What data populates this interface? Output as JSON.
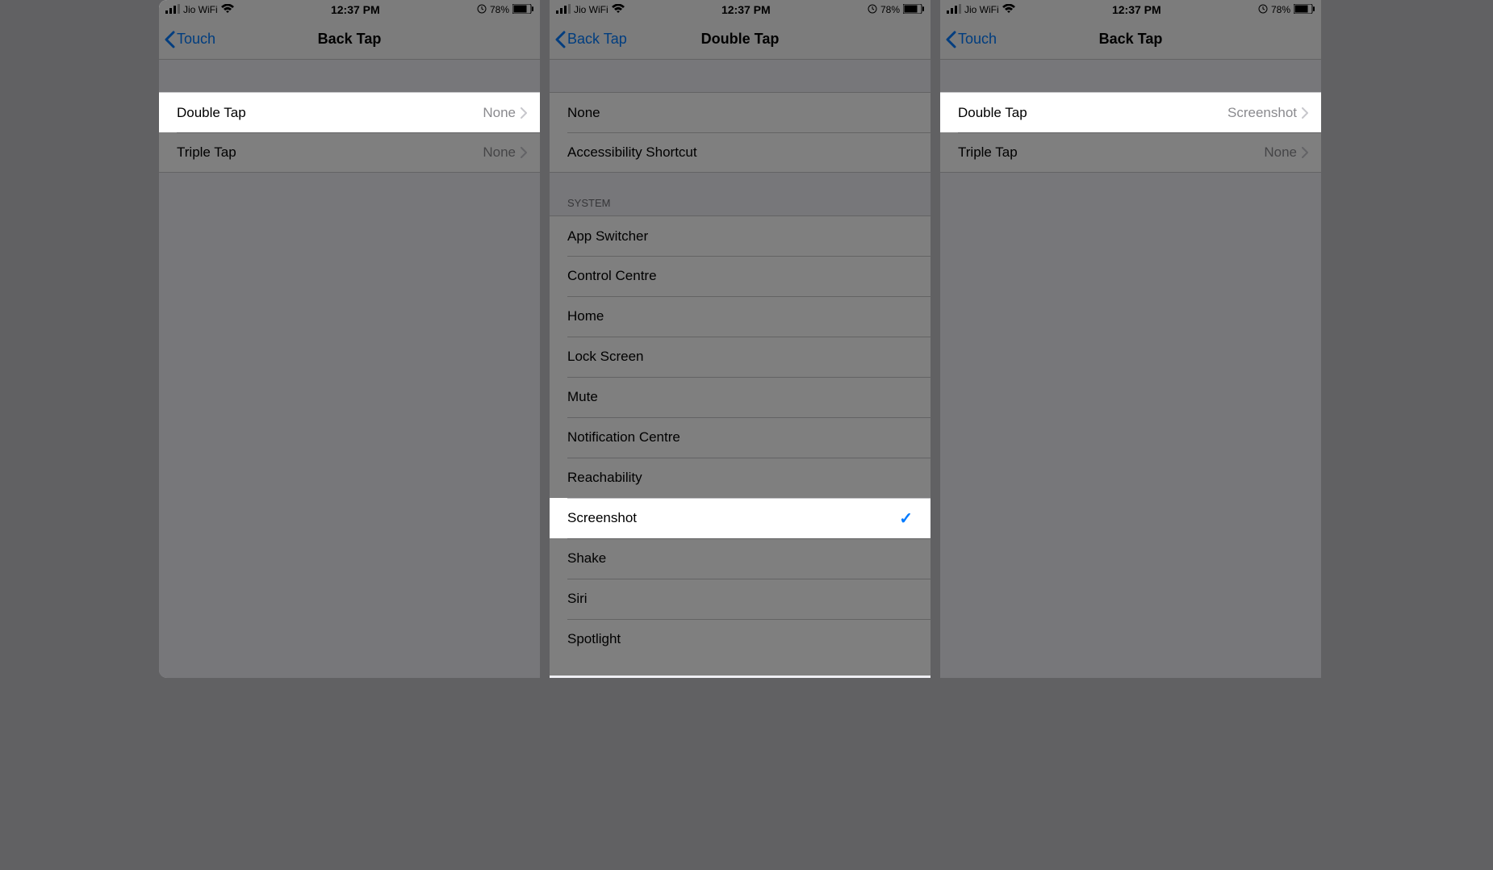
{
  "status": {
    "carrier": "Jio WiFi",
    "time": "12:37 PM",
    "battery": "78%",
    "alarm_icon": "⦿"
  },
  "screen1": {
    "back_label": "Touch",
    "title": "Back Tap",
    "rows": [
      {
        "label": "Double Tap",
        "value": "None"
      },
      {
        "label": "Triple Tap",
        "value": "None"
      }
    ]
  },
  "screen2": {
    "back_label": "Back Tap",
    "title": "Double Tap",
    "top_options": [
      "None",
      "Accessibility Shortcut"
    ],
    "section_header": "SYSTEM",
    "system_options": [
      "App Switcher",
      "Control Centre",
      "Home",
      "Lock Screen",
      "Mute",
      "Notification Centre",
      "Reachability",
      "Screenshot",
      "Shake",
      "Siri",
      "Spotlight"
    ],
    "selected": "Screenshot"
  },
  "screen3": {
    "back_label": "Touch",
    "title": "Back Tap",
    "rows": [
      {
        "label": "Double Tap",
        "value": "Screenshot"
      },
      {
        "label": "Triple Tap",
        "value": "None"
      }
    ]
  }
}
